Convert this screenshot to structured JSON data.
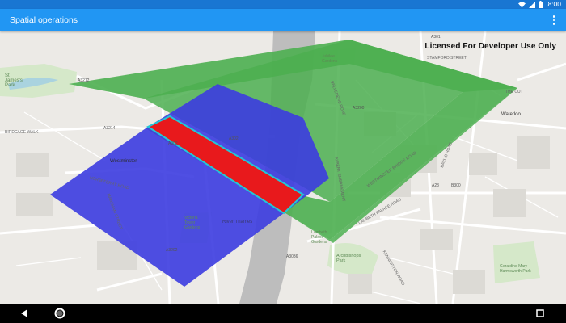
{
  "status_bar": {
    "time": "8:00"
  },
  "app_bar": {
    "title": "Spatial operations"
  },
  "map": {
    "license_text": "Licensed For Developer Use Only",
    "labels": [
      {
        "text": "St James's Park"
      },
      {
        "text": "Westminster"
      },
      {
        "text": "Victoria Tower Gardens"
      },
      {
        "text": "River Thames"
      },
      {
        "text": "Waterloo"
      },
      {
        "text": "Archbishops Park"
      },
      {
        "text": "Geraldine Mary Harmsworth Park"
      },
      {
        "text": "Lambeth Palace Gardens"
      },
      {
        "text": "Jubilee Gardens"
      },
      {
        "text": "BIRDCAGE WALK"
      },
      {
        "text": "BELVEDERE ROAD"
      },
      {
        "text": "STAMFORD STREET"
      },
      {
        "text": "THE CUT"
      },
      {
        "text": "ALBERT EMBANKMENT"
      },
      {
        "text": "LAMBETH PALACE ROAD"
      },
      {
        "text": "BAYLIS ROAD"
      },
      {
        "text": "WESTMINSTER BRIDGE ROAD"
      },
      {
        "text": "KENNINGTON ROAD"
      },
      {
        "text": "HORSEFERRY ROAD"
      },
      {
        "text": "MARSHAM STREET"
      },
      {
        "text": "A3212"
      },
      {
        "text": "A3214"
      },
      {
        "text": "A302"
      },
      {
        "text": "A3036"
      },
      {
        "text": "A23"
      },
      {
        "text": "A3200"
      },
      {
        "text": "A301"
      },
      {
        "text": "A3202"
      },
      {
        "text": "B300"
      },
      {
        "text": "A302"
      }
    ],
    "colors": {
      "polygon_outline": "#4caf50",
      "polygon_blue": "#3c3ce0",
      "intersection": "#e8191c",
      "intersection_border": "#22c7d6",
      "river": "#bdbdbd",
      "park": "#d5e8c9",
      "water": "#aad3df"
    }
  },
  "nav_bar": {
    "back_icon": "back-triangle-icon",
    "home_icon": "home-circle-icon",
    "recents_icon": "recents-square-icon"
  }
}
